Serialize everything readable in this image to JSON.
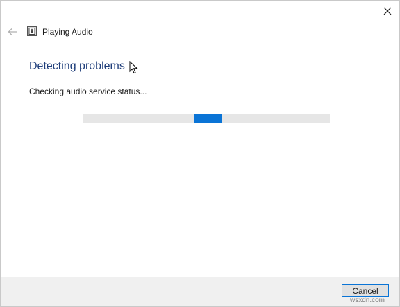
{
  "window": {
    "title": "Playing Audio",
    "title_icon": "audio-troubleshooter-icon",
    "close_icon": "close-icon",
    "back_icon": "back-arrow-icon"
  },
  "main": {
    "heading": "Detecting problems",
    "status": "Checking audio service status...",
    "progress": {
      "mode": "indeterminate",
      "indicator_color": "#0a74d6",
      "track_color": "#e6e6e6"
    }
  },
  "footer": {
    "cancel_label": "Cancel"
  },
  "watermark": "wsxdn.com",
  "colors": {
    "heading": "#1e3d7a",
    "accent": "#0a74d6"
  }
}
